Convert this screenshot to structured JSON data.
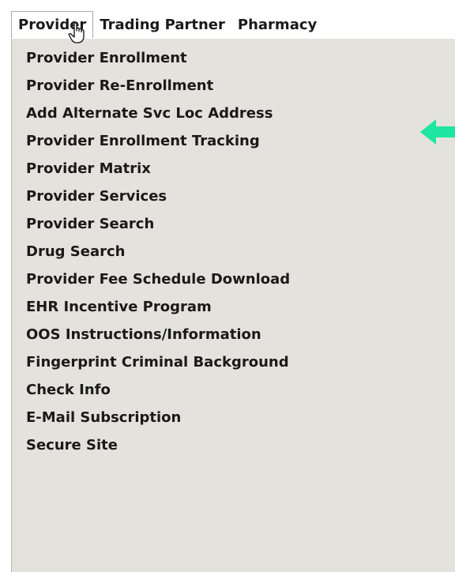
{
  "menubar": {
    "items": [
      {
        "label": "Provider",
        "active": true
      },
      {
        "label": "Trading Partner"
      },
      {
        "label": "Pharmacy"
      }
    ]
  },
  "dropdown": {
    "items": [
      {
        "label": "Provider Enrollment"
      },
      {
        "label": "Provider Re-Enrollment"
      },
      {
        "label": "Add Alternate Svc Loc Address",
        "highlighted_by_arrow": true
      },
      {
        "label": "Provider Enrollment Tracking"
      },
      {
        "label": "Provider Matrix"
      },
      {
        "label": "Provider Services"
      },
      {
        "label": "Provider Search"
      },
      {
        "label": "Drug Search"
      },
      {
        "label": "Provider Fee Schedule Download"
      },
      {
        "label": "EHR Incentive Program"
      },
      {
        "label": "OOS Instructions/Information"
      },
      {
        "label": "Fingerprint Criminal Background"
      },
      {
        "label": "Check Info"
      },
      {
        "label": "E-Mail Subscription"
      },
      {
        "label": "Secure Site"
      }
    ]
  },
  "colors": {
    "menu_background": "#e3e2dc",
    "text": "#1a1a1a",
    "annotation_arrow": "#1ee6a2"
  },
  "icons": {
    "cursor": "hand-pointer-icon",
    "annotation": "arrow-left-icon"
  }
}
